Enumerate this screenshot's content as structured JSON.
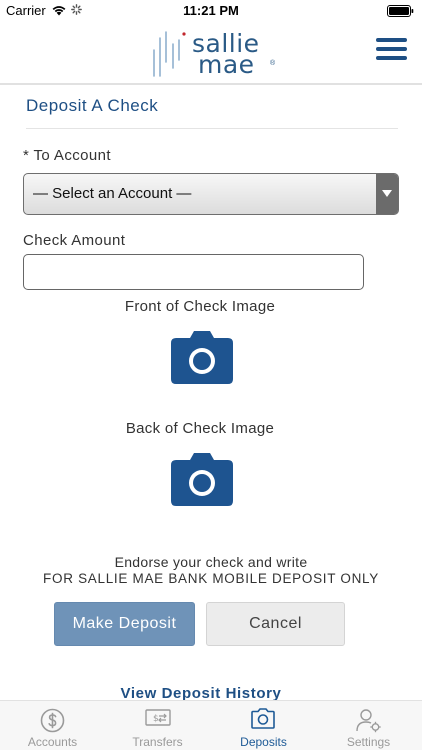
{
  "status_bar": {
    "carrier": "Carrier",
    "time": "11:21 PM"
  },
  "header": {
    "logo_line1": "sallie",
    "logo_line2": "mae",
    "logo_reg": "®"
  },
  "page": {
    "title": "Deposit A Check"
  },
  "form": {
    "to_account_label": "* To Account",
    "account_select_value": "— Select an Account —",
    "check_amount_label": "Check Amount",
    "check_amount_value": "",
    "front_label": "Front of Check Image",
    "back_label": "Back of Check Image"
  },
  "endorse": {
    "line1": "Endorse your check and write",
    "line2": "FOR SALLIE MAE BANK MOBILE DEPOSIT ONLY"
  },
  "buttons": {
    "make_deposit": "Make Deposit",
    "cancel": "Cancel"
  },
  "links": {
    "view_history": "View Deposit History"
  },
  "tab_bar": {
    "items": [
      {
        "label": "Accounts",
        "icon": "dollar-circle-icon",
        "active": false
      },
      {
        "label": "Transfers",
        "icon": "transfer-icon",
        "active": false
      },
      {
        "label": "Deposits",
        "icon": "camera-icon",
        "active": true
      },
      {
        "label": "Settings",
        "icon": "user-gear-icon",
        "active": false
      }
    ]
  },
  "colors": {
    "brand_blue": "#1e4f84",
    "primary_button": "#6f93b8",
    "camera_blue": "#1e5490",
    "tab_inactive": "#9a9a9a",
    "tab_active": "#1e5a96"
  }
}
